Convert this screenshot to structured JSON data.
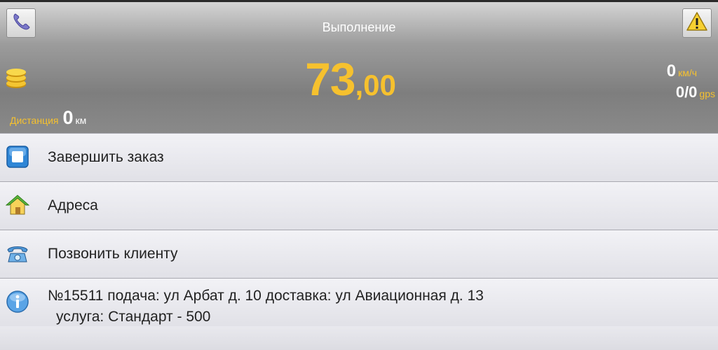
{
  "header": {
    "title": "Выполнение",
    "phone_icon": "handset-icon",
    "alert_icon": "warning-icon",
    "fare": {
      "integer": "73",
      "decimal": ",00"
    },
    "coins_icon": "coins-icon",
    "speed": {
      "value": "0",
      "unit": "км/ч"
    },
    "gps": {
      "value": "0/0",
      "unit": "gps"
    },
    "distance": {
      "label": "Дистанция",
      "value": "0",
      "unit": "км"
    }
  },
  "menu": {
    "finish": {
      "label": "Завершить заказ",
      "icon": "stop-icon"
    },
    "addresses": {
      "label": "Адреса",
      "icon": "house-icon"
    },
    "call": {
      "label": "Позвонить клиенту",
      "icon": "telephone-icon"
    }
  },
  "order": {
    "icon": "info-icon",
    "line1": "№15511 подача: ул Арбат д. 10 доставка: ул Авиационная д. 13",
    "line2": "услуга: Стандарт - 500"
  },
  "colors": {
    "accent": "#f6c12e",
    "header_dark": "#7e7e7e",
    "row_bg": "#e9e9ee"
  }
}
